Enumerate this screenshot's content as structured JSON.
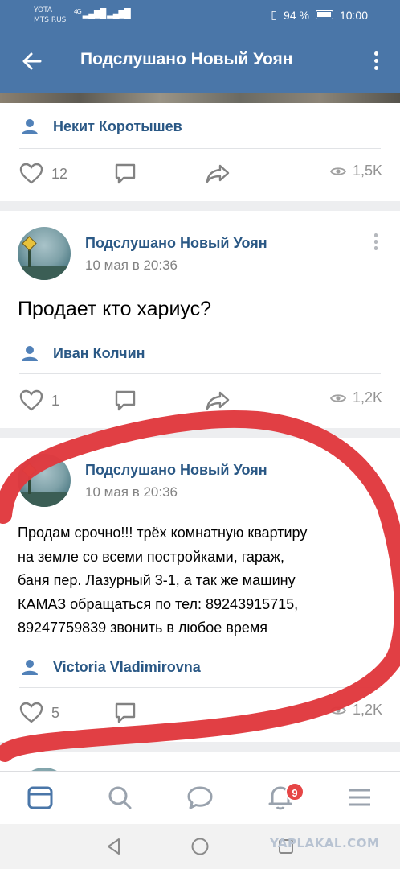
{
  "status_bar": {
    "carrier_line1": "YOTA",
    "carrier_line2": "MTS RUS",
    "signal_text": "4G",
    "battery": "94 %",
    "time": "10:00"
  },
  "header": {
    "title": "Подслушано Новый Уоян"
  },
  "posts": [
    {
      "author": "Некит Коротышев",
      "likes": "12",
      "views": "1,5K"
    },
    {
      "publisher": "Подслушано Новый Уоян",
      "date": "10 мая в 20:36",
      "text": "Продает кто хариус?",
      "author": "Иван Колчин",
      "likes": "1",
      "views": "1,2K"
    },
    {
      "publisher": "Подслушано Новый Уоян",
      "date": "10 мая в 20:36",
      "text": "Продам срочно!!! трёх комнатную квартиру\nна земле со всеми постройками, гараж,\nбаня пер. Лазурный 3-1, а так же машину\nКАМАЗ обращаться по тел: 89243915715,\n89247759839 звонить в любое время",
      "author": "Victoria Vladimirovna",
      "likes": "5",
      "views": "1,2K"
    }
  ],
  "tabbar": {
    "notifications_badge": "9"
  },
  "watermark": "YAPLAKAL.COM",
  "colors": {
    "header": "#4a76a8",
    "link": "#2a5885",
    "badge": "#e64646",
    "annotation": "#e0393e"
  }
}
